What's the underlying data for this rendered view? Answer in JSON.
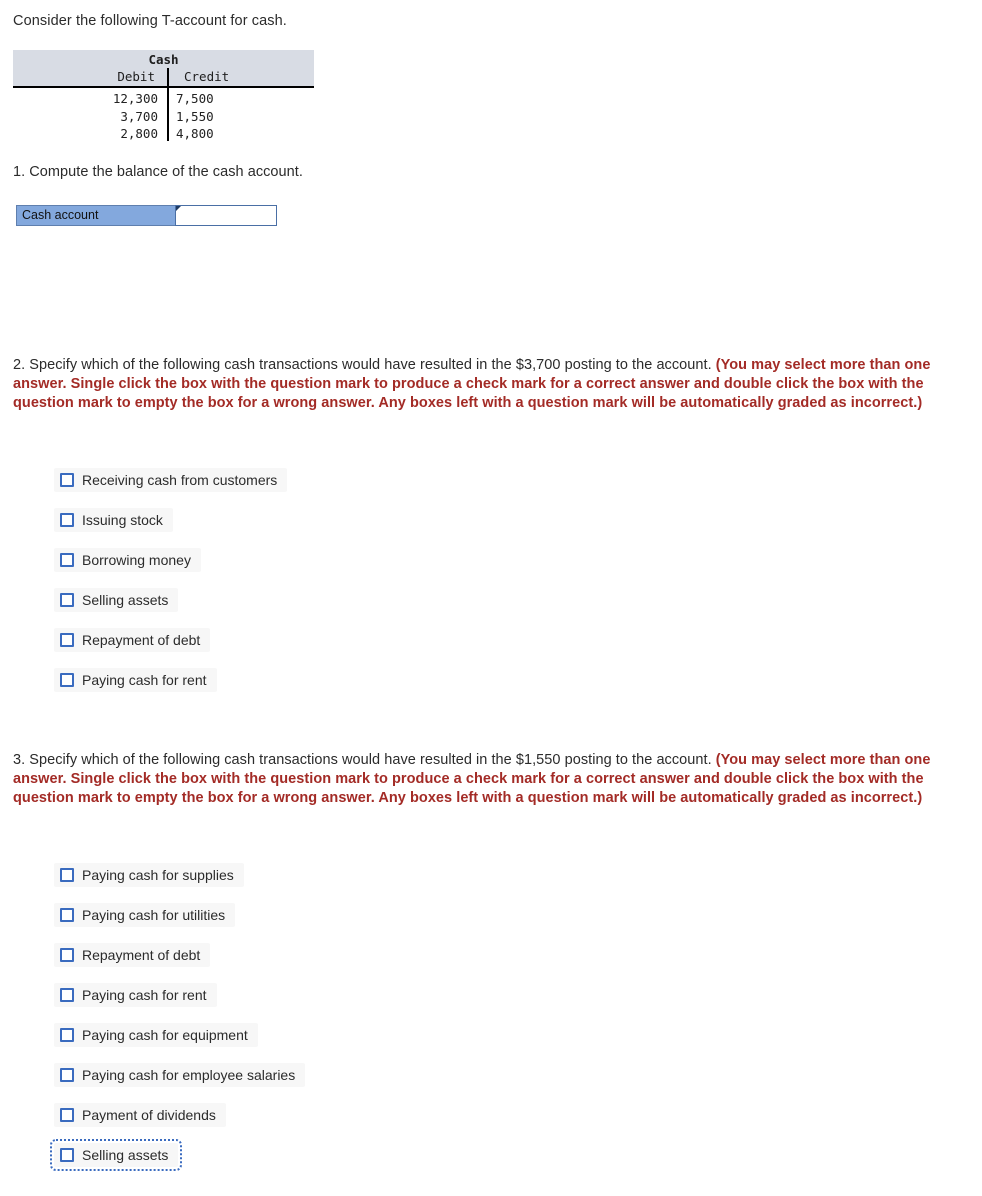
{
  "intro": {
    "text": "Consider the following T-account for cash."
  },
  "t_account": {
    "title": "Cash",
    "columns": [
      "Debit",
      "Credit"
    ],
    "rows": [
      {
        "debit": "12,300",
        "credit": "7,500"
      },
      {
        "debit": "3,700",
        "credit": "1,550"
      },
      {
        "debit": "2,800",
        "credit": "4,800"
      }
    ]
  },
  "colors": {
    "red_instruction": "#a32b26",
    "answer_cell_fill": "#83a8dd",
    "checkbox_border": "#3a6bbf",
    "table_header_fill": "#d8dce4",
    "option_pill_fill": "#f7f7f7"
  },
  "question1": {
    "heading": "1. Compute the balance of the cash account.",
    "row_label": "Cash account",
    "input_value": "",
    "input_placeholder": ""
  },
  "question2": {
    "heading_plain": "2. Specify which of the following cash transactions would have resulted in the $3,700 posting to the account. ",
    "heading_red": "(You may select more than one answer. Single click the box with the question mark to produce a check mark for a correct answer and double click the box with the question mark to empty the box for a wrong answer. Any boxes left with a question mark will be automatically graded as incorrect.)",
    "options": [
      {
        "label": "Receiving cash from customers",
        "checked": false,
        "focused": false
      },
      {
        "label": "Issuing stock",
        "checked": false,
        "focused": false
      },
      {
        "label": "Borrowing money",
        "checked": false,
        "focused": false
      },
      {
        "label": "Selling assets",
        "checked": false,
        "focused": false
      },
      {
        "label": "Repayment of debt",
        "checked": false,
        "focused": false
      },
      {
        "label": "Paying cash for rent",
        "checked": false,
        "focused": false
      }
    ]
  },
  "question3": {
    "heading_plain": "3. Specify which of the following cash transactions would have resulted in the $1,550 posting to the account. ",
    "heading_red": "(You may select more than one answer. Single click the box with the question mark to produce a check mark for a correct answer and double click the box with the question mark to empty the box for a wrong answer. Any boxes left with a question mark will be automatically graded as incorrect.)",
    "options": [
      {
        "label": "Paying cash for supplies",
        "checked": false,
        "focused": false
      },
      {
        "label": "Paying cash for utilities",
        "checked": false,
        "focused": false
      },
      {
        "label": "Repayment of debt",
        "checked": false,
        "focused": false
      },
      {
        "label": "Paying cash for rent",
        "checked": false,
        "focused": false
      },
      {
        "label": "Paying cash for equipment",
        "checked": false,
        "focused": false
      },
      {
        "label": "Paying cash for employee salaries",
        "checked": false,
        "focused": false
      },
      {
        "label": "Payment of dividends",
        "checked": false,
        "focused": false
      },
      {
        "label": "Selling assets",
        "checked": false,
        "focused": true
      }
    ]
  }
}
